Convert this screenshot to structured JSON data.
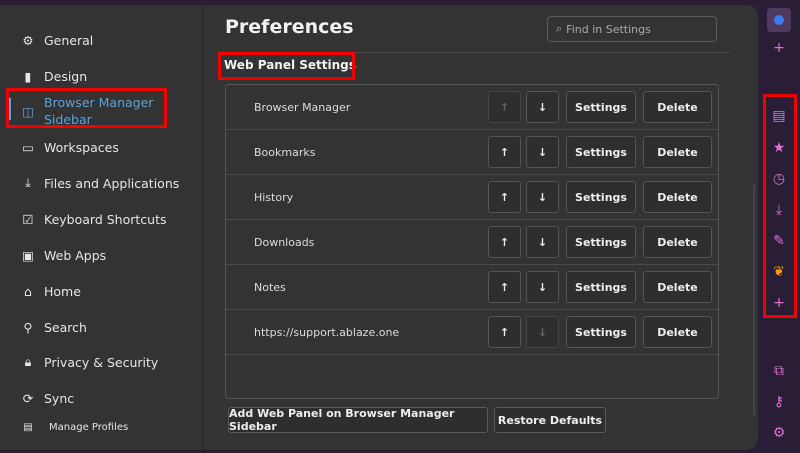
{
  "sidebar": {
    "items": [
      {
        "label": "General",
        "icon": "gear-icon"
      },
      {
        "label": "Design",
        "icon": "paintbrush-icon"
      },
      {
        "label": "Browser Manager Sidebar",
        "icon": "sidebar-icon",
        "active": true
      },
      {
        "label": "Workspaces",
        "icon": "window-icon"
      },
      {
        "label": "Files and Applications",
        "icon": "download-icon"
      },
      {
        "label": "Keyboard Shortcuts",
        "icon": "checkbox-icon"
      },
      {
        "label": "Web Apps",
        "icon": "monitor-icon"
      },
      {
        "label": "Home",
        "icon": "home-icon"
      },
      {
        "label": "Search",
        "icon": "search-icon"
      },
      {
        "label": "Privacy & Security",
        "icon": "lock-icon"
      },
      {
        "label": "Sync",
        "icon": "sync-icon"
      }
    ],
    "manage_profiles": "Manage Profiles"
  },
  "header": {
    "title": "Preferences",
    "search_placeholder": "Find in Settings"
  },
  "section": {
    "title": "Web Panel Settings"
  },
  "panels": [
    {
      "name": "Browser Manager",
      "up_enabled": false,
      "down_enabled": true
    },
    {
      "name": "Bookmarks",
      "up_enabled": true,
      "down_enabled": true
    },
    {
      "name": "History",
      "up_enabled": true,
      "down_enabled": true
    },
    {
      "name": "Downloads",
      "up_enabled": true,
      "down_enabled": true
    },
    {
      "name": "Notes",
      "up_enabled": true,
      "down_enabled": true
    },
    {
      "name": "https://support.ablaze.one",
      "up_enabled": true,
      "down_enabled": false
    }
  ],
  "row_buttons": {
    "up": "↑",
    "down": "↓",
    "settings": "Settings",
    "delete": "Delete"
  },
  "footer": {
    "add": "Add Web Panel on Browser Manager Sidebar",
    "restore": "Restore Defaults"
  },
  "colors": {
    "accent": "#5aa2db",
    "highlight": "#f00000",
    "strip_icon": "#e06fd6"
  }
}
